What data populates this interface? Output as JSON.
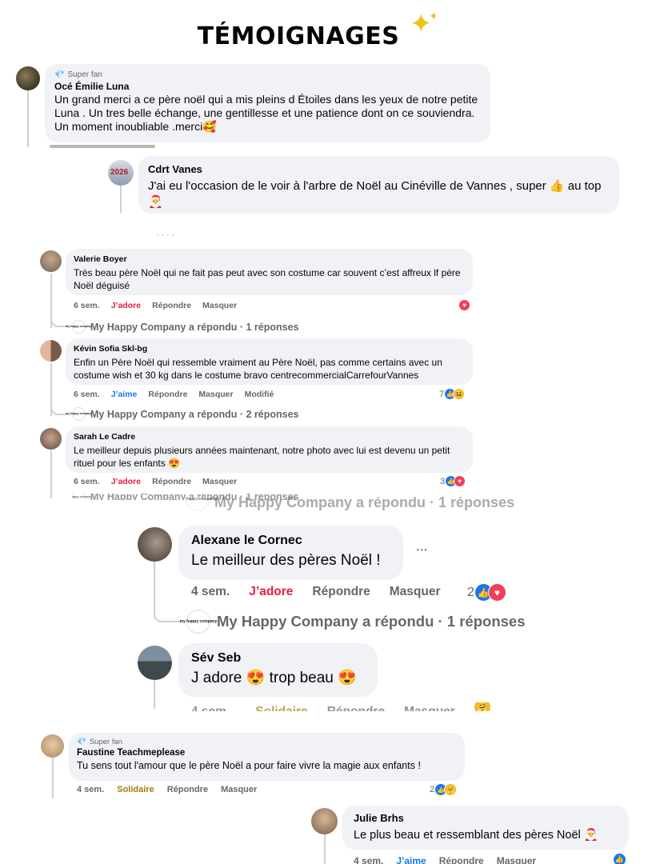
{
  "title": "TÉMOIGNAGES",
  "sparkle_icon": "sparkles-icon",
  "labels": {
    "super_fan": "Super fan",
    "jadore": "J’adore",
    "jaime": "J’aime",
    "solidaire": "Solidaire",
    "repondre": "Répondre",
    "masquer": "Masquer",
    "modifie": "Modifié",
    "more_dots": "•••"
  },
  "colors": {
    "love": "#e41e3f",
    "like": "#1877f2",
    "support": "#a57b0e",
    "bubble": "#f0f2f5",
    "meta": "#65676b"
  },
  "comments": [
    {
      "name": "Océ Émilie Luna",
      "badge": "Super fan",
      "text": "Un grand merci a ce père noël qui a mis pleins d Étoiles dans les yeux de notre petite Luna . Un tres belle échange, une gentillesse et une patience dont on ce souviendra. Un moment inoubliable .merci🥰"
    },
    {
      "name": "Cdrt Vanes",
      "text": "J'ai eu l'occasion de le voir à l'arbre de Noël au Cinéville de Vannes , super 👍 au top 🎅"
    },
    {
      "name": "Valerie Boyer",
      "text": "Très beau père Noël qui ne fait pas peut avec son costume car souvent c’est affreux lf père Noël déguisé",
      "time": "6 sem.",
      "reaction": "J’adore",
      "reply": "My Happy Company a répondu · 1 réponses"
    },
    {
      "name": "Kévin Sofia Skl-bg",
      "text": "Enfin un Père Noël qui ressemble vraiment au Père Noël, pas comme certains avec un costume wish et 30 kg dans le costume bravo centrecommercialCarrefourVannes",
      "time": "6 sem.",
      "reaction": "J’aime",
      "edited": "Modifié",
      "count": "7",
      "reply": "My Happy Company a répondu · 2 réponses"
    },
    {
      "name": "Sarah Le Cadre",
      "text": "Le meilleur depuis plusieurs années maintenant, notre photo avec lui est devenu un petit rituel pour les enfants 😍",
      "time": "6 sem.",
      "reaction": "J’adore",
      "count": "3",
      "reply_partial": "My Happy Company a répondu · 1 réponses"
    },
    {
      "name": "Alexane le Cornec",
      "text": "Le meilleur des pères Noël !",
      "time": "4 sem.",
      "reaction": "J’adore",
      "count": "2",
      "reply_top": "My Happy Company a répondu · 1 réponses",
      "reply": "My Happy Company a répondu · 1 réponses"
    },
    {
      "name": "Sév Seb",
      "text": "J adore 😍 trop beau 😍",
      "time_partial": "4 sem.",
      "reaction_partial": "Solidaire"
    },
    {
      "name": "Faustine Teachmeplease",
      "badge": "Super fan",
      "text": "Tu sens tout l'amour que le père Noël a pour faire vivre la magie aux enfants !",
      "time": "4 sem.",
      "reaction": "Solidaire",
      "count": "2"
    },
    {
      "name": "Julie Brhs",
      "text": "Le plus beau et ressemblant des pères Noël 🎅",
      "time": "4 sem.",
      "reaction": "J’aime"
    }
  ],
  "avatar_badge_text": "2026",
  "logo_text": "my happy company"
}
